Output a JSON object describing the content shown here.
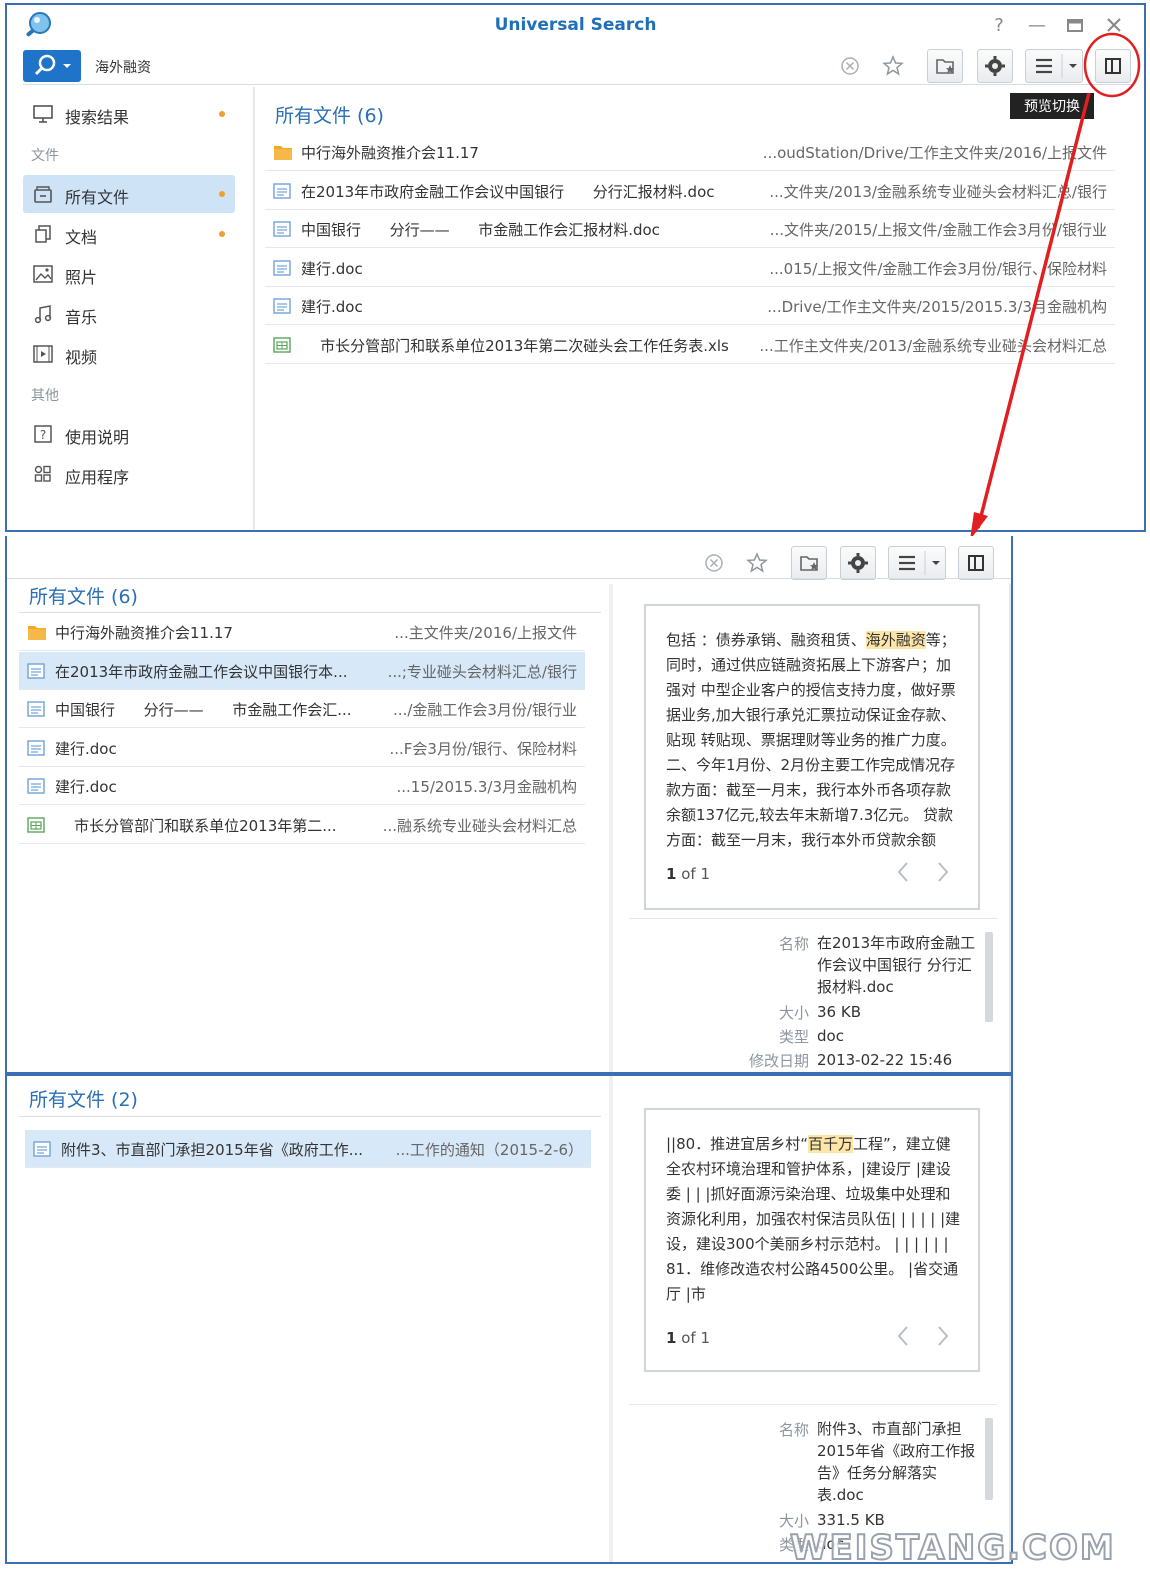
{
  "app": {
    "title": "Universal Search"
  },
  "search": {
    "query": "海外融资"
  },
  "tooltip": "预览切换",
  "sidebar": {
    "items": [
      {
        "label": "搜索结果",
        "icon": "monitor-icon"
      },
      {
        "label": "所有文件",
        "icon": "all-files-icon"
      },
      {
        "label": "文档",
        "icon": "documents-icon"
      },
      {
        "label": "照片",
        "icon": "photo-icon"
      },
      {
        "label": "音乐",
        "icon": "music-icon"
      },
      {
        "label": "视频",
        "icon": "video-icon"
      },
      {
        "label": "使用说明",
        "icon": "help-icon"
      },
      {
        "label": "应用程序",
        "icon": "apps-icon"
      }
    ],
    "sections": {
      "files": "文件",
      "other": "其他"
    }
  },
  "results1": {
    "title": "所有文件 (6)",
    "rows": [
      {
        "name": "中行海外融资推介会11.17",
        "path": "...oudStation/Drive/工作主文件夹/2016/上报文件",
        "type": "folder"
      },
      {
        "name": "在2013年市政府金融工作会议中国银行      分行汇报材料.doc",
        "path": "...文件夹/2013/金融系统专业碰头会材料汇总/银行",
        "type": "doc"
      },
      {
        "name": "中国银行      分行——      市金融工作会汇报材料.doc",
        "path": "...文件夹/2015/上报文件/金融工作会3月份/银行业",
        "type": "doc"
      },
      {
        "name": "建行.doc",
        "path": "...015/上报文件/金融工作会3月份/银行、保险材料",
        "type": "doc"
      },
      {
        "name": "建行.doc",
        "path": "...Drive/工作主文件夹/2015/2015.3/3月金融机构",
        "type": "doc"
      },
      {
        "name": "    市长分管部门和联系单位2013年第二次碰头会工作任务表.xls",
        "path": "...工作主文件夹/2013/金融系统专业碰头会材料汇总",
        "type": "xls"
      }
    ]
  },
  "results2": {
    "title": "所有文件 (6)",
    "rows": [
      {
        "name": "中行海外融资推介会11.17",
        "path": "...主文件夹/2016/上报文件",
        "type": "folder"
      },
      {
        "name": "在2013年市政府金融工作会议中国银行本...",
        "path": "...;专业碰头会材料汇总/银行",
        "type": "doc"
      },
      {
        "name": "中国银行      分行——      市金融工作会汇...",
        "path": ".../金融工作会3月份/银行业",
        "type": "doc"
      },
      {
        "name": "建行.doc",
        "path": "...F会3月份/银行、保险材料",
        "type": "doc"
      },
      {
        "name": "建行.doc",
        "path": "...15/2015.3/3月金融机构",
        "type": "doc"
      },
      {
        "name": "    市长分管部门和联系单位2013年第二...",
        "path": "...融系统专业碰头会材料汇总",
        "type": "xls"
      }
    ],
    "preview": {
      "text_before": "包括 ：债券承销、融资租赁、",
      "highlight": "海外融资",
      "text_after": "等；同时，通过供应链融资拓展上下游客户；加强对 中型企业客户的授信支持力度，做好票据业务,加大银行承兑汇票拉动保证金存款、贴现 转贴现、票据理财等业务的推广力度。二、今年1月份、2月份主要工作完成情况存款方面：截至一月末，我行本外币各项存款余额137亿元,较去年末新增7.3亿元。 贷款方面：截至一月末，我行本外币贷款余额",
      "page_num": "1",
      "page_of": "of 1"
    },
    "meta": {
      "name_label": "名称",
      "name_value": "在2013年市政府金融工作会议中国银行      分行汇报材料.doc",
      "size_label": "大小",
      "size_value": "36 KB",
      "type_label": "类型",
      "type_value": "doc",
      "date_label": "修改日期",
      "date_value": "2013-02-22 15:46"
    }
  },
  "results3": {
    "title": "所有文件 (2)",
    "rows": [
      {
        "name": "附件3、市直部门承担2015年省《政府工作...",
        "path": "...工作的通知（2015-2-6）",
        "type": "doc"
      }
    ],
    "preview": {
      "text_before": "      ||80．推进宜居乡村“",
      "highlight": "百千万",
      "text_after": "工程”，建立健全农村环境治理和管护体系，|建设厅 |建设委 | | |抓好面源污染治理、垃圾集中处理和资源化利用，加强农村保洁员队伍| | | | | |建设，建设300个美丽乡村示范村。 | | | | | | 81．维修改造农村公路4500公里。 |省交通厅 |市",
      "page_num": "1",
      "page_of": "of 1"
    },
    "meta": {
      "name_label": "名称",
      "name_value": "附件3、市直部门承担2015年省《政府工作报告》任务分解落实表.doc",
      "size_label": "大小",
      "size_value": "331.5 KB",
      "type_label": "类型",
      "type_value": "doc"
    }
  },
  "watermark": "WEISTANG.COM",
  "colors": {
    "accent": "#1f73c8",
    "selected": "#d7e8f8",
    "highlight": "#fde6a8",
    "annotation": "#e02020"
  }
}
